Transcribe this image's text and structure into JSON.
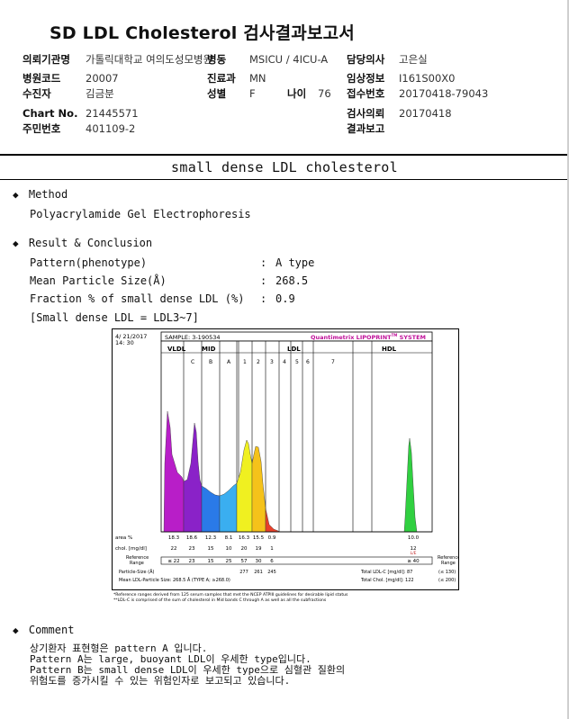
{
  "report": {
    "title": "SD LDL Cholesterol 검사결과보고서",
    "fields": {
      "institution_label": "의뢰기관명",
      "institution_value": "가톨릭대학교 여의도성모병원",
      "ward_label": "병동",
      "ward_value": "MSICU / 4ICU-A",
      "doctor_label": "담당의사",
      "doctor_value": "고은실",
      "hospital_code_label": "병원코드",
      "hospital_code_value": "20007",
      "dept_label": "진료과",
      "dept_value": "MN",
      "clinical_label": "임상정보",
      "clinical_value": "I161S00X0",
      "patient_label": "수진자",
      "patient_value": "김금분",
      "sex_label": "성별",
      "sex_value": "F",
      "age_label": "나이",
      "age_value": "76",
      "receipt_label": "접수번호",
      "receipt_value": "20170418-79043",
      "chart_label": "Chart No.",
      "chart_value": "21445571",
      "request_date_label": "검사의뢰",
      "request_date_value": "20170418",
      "rrn_label": "주민번호",
      "rrn_value": "401109-2",
      "report_date_label": "결과보고",
      "report_date_value": ""
    }
  },
  "section": {
    "title": "small dense LDL cholesterol",
    "method_heading": "Method",
    "method_text": "Polyacrylamide Gel Electrophoresis",
    "result_heading": "Result & Conclusion",
    "results": [
      {
        "label": "Pattern(phenotype)",
        "sep": ":",
        "value": "A type"
      },
      {
        "label": "Mean Particle Size(Å)",
        "sep": ":",
        "value": "268.5"
      },
      {
        "label": "Fraction % of small dense LDL (%)",
        "sep": ":",
        "value": "0.9"
      }
    ],
    "range_note": "[Small dense LDL = LDL3~7]",
    "comment_heading": "Comment",
    "comment_lines": [
      "상기환자 표현형은 pattern A 입니다.",
      "Pattern A는 large, buoyant LDL이 우세한 type입니다.",
      "Pattern B는 small dense LDL이 우세한 type으로 심혈관 질환의",
      "위험도를 증가시킬 수 있는 위험인자로 보고되고 있습니다."
    ],
    "bullet": "◆"
  },
  "chart_data": {
    "type": "area",
    "date": "4/ 21/2017",
    "time": "14: 30",
    "sample": "SAMPLE:  3-190534",
    "brand": "Quantimetrix LIPOPRINT",
    "brand_tm": "TM",
    "brand_tail": " SYSTEM",
    "regions": [
      "VLDL",
      "MID",
      "LDL",
      "HDL"
    ],
    "mid_bands": [
      "C",
      "B",
      "A"
    ],
    "ldl_bands": [
      "1",
      "2",
      "3",
      "4",
      "5",
      "6",
      "7"
    ],
    "band_colors": {
      "VLDL": "#b81ec8",
      "C": "#8a22c8",
      "B": "#2a7ae8",
      "A": "#3aaef0",
      "1": "#f0f020",
      "2": "#f5c21a",
      "3": "#e8402a",
      "HDL": "#30d040"
    },
    "table": {
      "row_labels": [
        "area %",
        "chol. [mg/dl]",
        "Reference\nRange"
      ],
      "area_pct": [
        "18.3",
        "18.6",
        "12.3",
        "8.1",
        "16.3",
        "15.5",
        "0.9",
        "",
        "",
        "",
        "",
        "10.0"
      ],
      "chol": [
        "22",
        "23",
        "15",
        "10",
        "20",
        "19",
        "1",
        "",
        "",
        "",
        "",
        "12"
      ],
      "ref_range": [
        "≤ 22",
        "23",
        "15",
        "25",
        "57",
        "30",
        "6",
        "",
        "",
        "",
        "",
        "≥ 40"
      ],
      "ldl_mark": "L/E",
      "ref_range_right": "Reference\nRange",
      "particle_size_label": "Particle-Size (Å)",
      "particle_sizes": [
        "277",
        "261",
        "245"
      ],
      "mean_ldl_label": "Mean LDL-Particle Size:  268.5 Å  (TYPE A; ≥268.0)",
      "total_ldl_label": "Total LDL-C [mg/dl]:  87",
      "total_ldl_ref": "(≤ 130)",
      "total_chol_label": "Total Chol. [mg/dl]:  122",
      "total_chol_ref": "(≤ 200)"
    },
    "footnotes": [
      "*Reference ranges derived from 125 serum samples that met the NCEP ATPIII guidelines for desirable lipid status",
      "**LDL-C is comprised of the sum of cholesterol in Mid bands C through A as well as all the subfractions"
    ]
  }
}
